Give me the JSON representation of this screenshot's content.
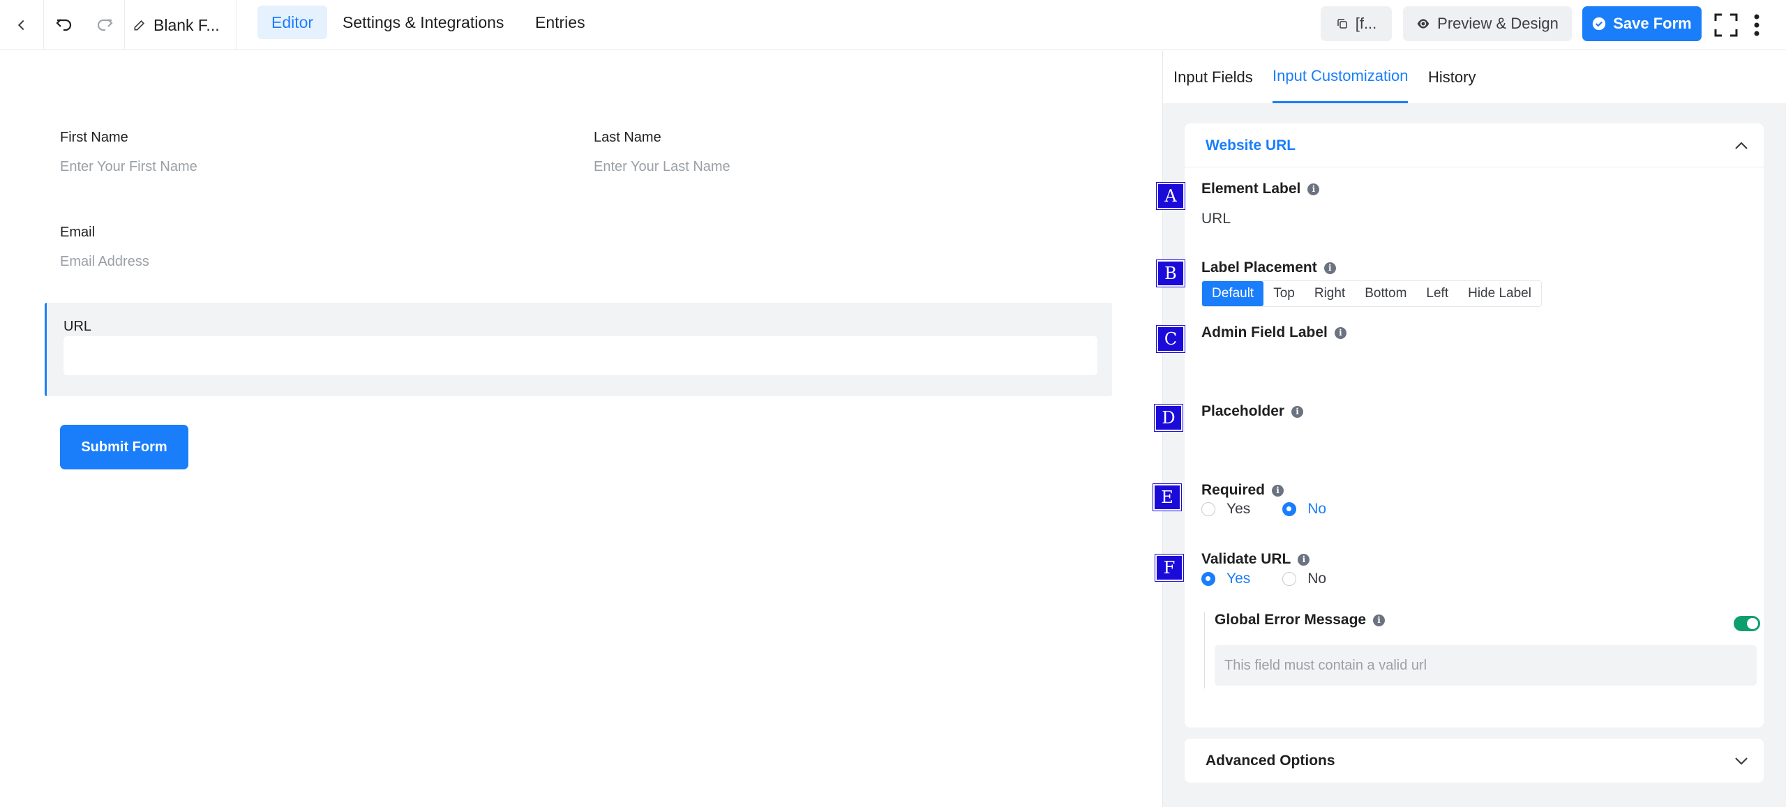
{
  "topbar": {
    "form_title": "Blank F...",
    "nav": [
      "Editor",
      "Settings & Integrations",
      "Entries"
    ],
    "shortcode_label": "[f...",
    "preview_label": "Preview & Design",
    "save_label": "Save Form"
  },
  "form": {
    "first_name": {
      "label": "First Name",
      "placeholder": "Enter Your First Name"
    },
    "last_name": {
      "label": "Last Name",
      "placeholder": "Enter Your Last Name"
    },
    "email": {
      "label": "Email",
      "placeholder": "Email Address"
    },
    "url": {
      "label": "URL",
      "value": ""
    },
    "submit_label": "Submit Form"
  },
  "panel": {
    "tabs": [
      "Input Fields",
      "Input Customization",
      "History"
    ],
    "active_tab": "Input Customization",
    "section_title": "Website URL",
    "element_label": {
      "label": "Element Label",
      "value": "URL"
    },
    "label_placement": {
      "label": "Label Placement",
      "options": [
        "Default",
        "Top",
        "Right",
        "Bottom",
        "Left",
        "Hide Label"
      ],
      "selected": "Default"
    },
    "admin_field_label": {
      "label": "Admin Field Label",
      "value": ""
    },
    "placeholder": {
      "label": "Placeholder",
      "value": ""
    },
    "required": {
      "label": "Required",
      "options": [
        "Yes",
        "No"
      ],
      "selected": "No"
    },
    "validate_url": {
      "label": "Validate URL",
      "options": [
        "Yes",
        "No"
      ],
      "selected": "Yes"
    },
    "global_error": {
      "label": "Global Error Message",
      "enabled": true,
      "placeholder": "This field must contain a valid url"
    },
    "advanced_title": "Advanced Options"
  },
  "badges": [
    "A",
    "B",
    "C",
    "D",
    "E",
    "F"
  ],
  "colors": {
    "accent": "#1a7efb",
    "toggle_on": "#0e9f6e",
    "badge": "#1b0bd9"
  }
}
